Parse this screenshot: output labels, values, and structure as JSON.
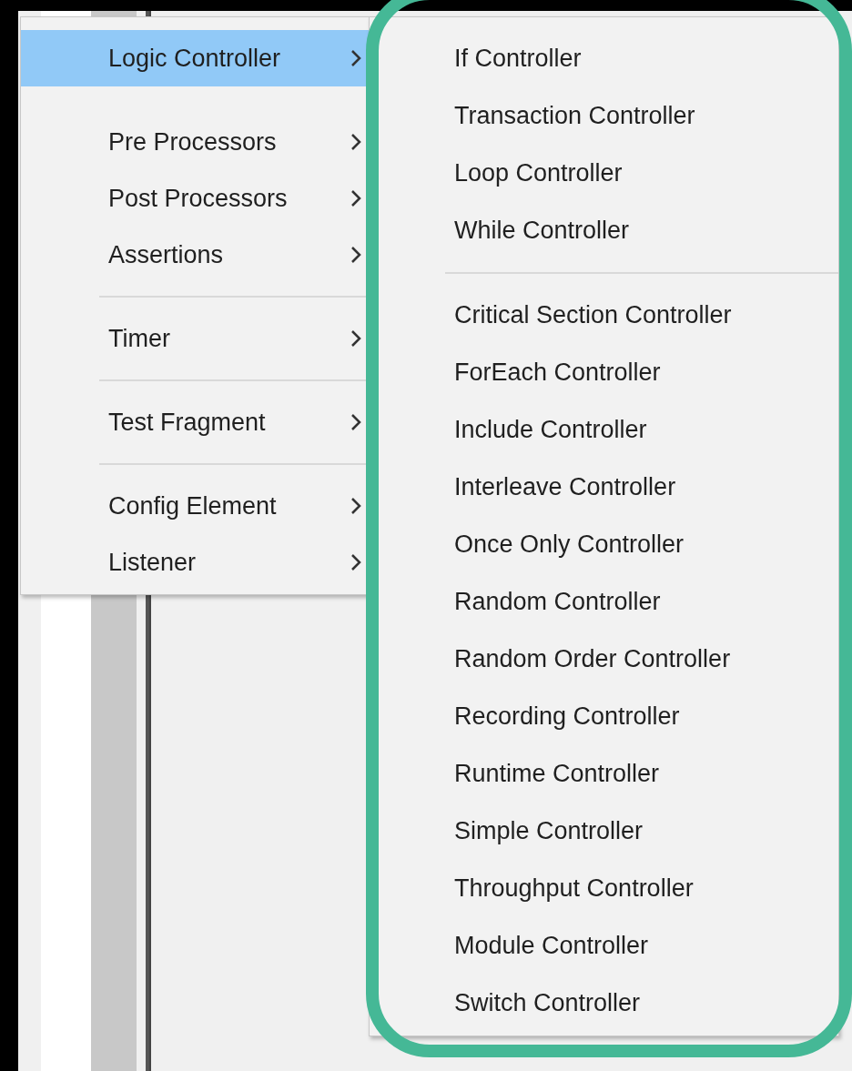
{
  "menu": {
    "items": [
      {
        "kind": "item",
        "label": "Logic Controller",
        "selected": true
      },
      {
        "kind": "spacer"
      },
      {
        "kind": "item",
        "label": "Pre Processors",
        "selected": false
      },
      {
        "kind": "item",
        "label": "Post Processors",
        "selected": false
      },
      {
        "kind": "item",
        "label": "Assertions",
        "selected": false
      },
      {
        "kind": "separator"
      },
      {
        "kind": "item",
        "label": "Timer",
        "selected": false
      },
      {
        "kind": "separator"
      },
      {
        "kind": "item",
        "label": "Test Fragment",
        "selected": false
      },
      {
        "kind": "separator"
      },
      {
        "kind": "item",
        "label": "Config Element",
        "selected": false
      },
      {
        "kind": "item",
        "label": "Listener",
        "selected": false
      }
    ]
  },
  "submenu": {
    "items": [
      {
        "kind": "item",
        "label": "If Controller"
      },
      {
        "kind": "item",
        "label": "Transaction Controller"
      },
      {
        "kind": "item",
        "label": "Loop Controller"
      },
      {
        "kind": "item",
        "label": "While Controller"
      },
      {
        "kind": "separator"
      },
      {
        "kind": "item",
        "label": "Critical Section Controller"
      },
      {
        "kind": "item",
        "label": "ForEach Controller"
      },
      {
        "kind": "item",
        "label": "Include Controller"
      },
      {
        "kind": "item",
        "label": "Interleave Controller"
      },
      {
        "kind": "item",
        "label": "Once Only Controller"
      },
      {
        "kind": "item",
        "label": "Random Controller"
      },
      {
        "kind": "item",
        "label": "Random Order Controller"
      },
      {
        "kind": "item",
        "label": "Recording Controller"
      },
      {
        "kind": "item",
        "label": "Runtime Controller"
      },
      {
        "kind": "item",
        "label": "Simple Controller"
      },
      {
        "kind": "item",
        "label": "Throughput Controller"
      },
      {
        "kind": "item",
        "label": "Module Controller"
      },
      {
        "kind": "item",
        "label": "Switch Controller"
      }
    ]
  }
}
